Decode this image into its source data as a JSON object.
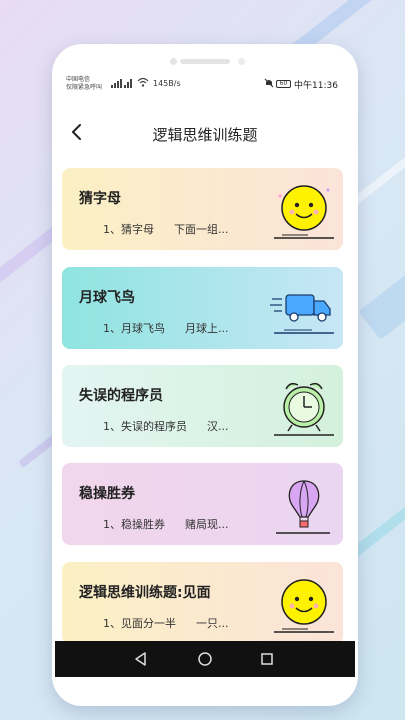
{
  "status_bar": {
    "carrier_line1": "中国电信",
    "carrier_line2": "仅限紧急呼叫",
    "signal_icon": "signal-icon",
    "wifi_icon": "wifi-icon",
    "network_speed": "145B/s",
    "battery": "60",
    "time": "中午11:36"
  },
  "header": {
    "title": "逻辑思维训练题",
    "back_icon": "back-arrow-icon"
  },
  "cards": [
    {
      "title": "猜字母",
      "sub1": "1、猜字母",
      "sub2": "下面一组...",
      "icon": "smiley-face-icon",
      "color_start": "#fbf0c4",
      "color_end": "#fbe3d9"
    },
    {
      "title": "月球飞鸟",
      "sub1": "1、月球飞鸟",
      "sub2": "月球上...",
      "icon": "delivery-truck-icon",
      "color_start": "#8fe4e0",
      "color_end": "#c7e6f6"
    },
    {
      "title": "失误的程序员",
      "sub1": "1、失误的程序员",
      "sub2": "汉...",
      "icon": "alarm-clock-icon",
      "color_start": "#e3f5f2",
      "color_end": "#d4f1dc"
    },
    {
      "title": "稳操胜券",
      "sub1": "1、稳操胜券",
      "sub2": "赌局现...",
      "icon": "hot-air-balloon-icon",
      "color_start": "#f2d6ec",
      "color_end": "#ead6f0"
    },
    {
      "title": "逻辑思维训练题:见面",
      "sub1": "1、见面分一半",
      "sub2": "一只...",
      "icon": "smiley-face-icon",
      "color_start": "#fbf0c4",
      "color_end": "#fbe3d9"
    }
  ]
}
